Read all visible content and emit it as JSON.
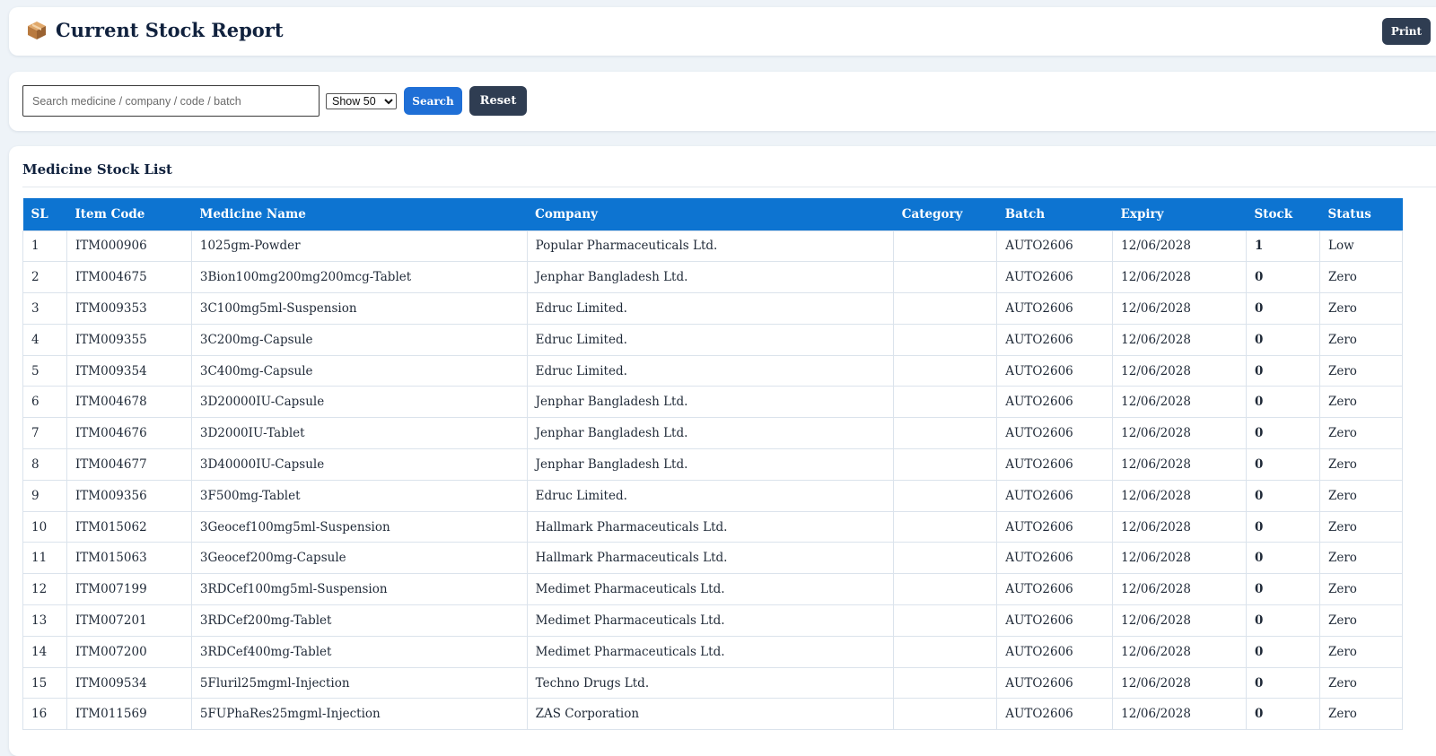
{
  "header": {
    "title": "Current Stock Report",
    "title_icon": "package-box-icon",
    "print_label": "Print"
  },
  "filters": {
    "search_placeholder": "Search medicine / company / code / batch",
    "search_value": "",
    "show_selected": "Show 50",
    "search_label": "Search",
    "reset_label": "Reset"
  },
  "list": {
    "title": "Medicine Stock List",
    "columns": [
      "SL",
      "Item Code",
      "Medicine Name",
      "Company",
      "Category",
      "Batch",
      "Expiry",
      "Stock",
      "Status"
    ],
    "rows": [
      {
        "sl": "1",
        "code": "ITM000906",
        "name": "1025gm-Powder",
        "company": "Popular Pharmaceuticals Ltd.",
        "category": "",
        "batch": "AUTO2606",
        "expiry": "12/06/2028",
        "stock": "1",
        "status": "Low"
      },
      {
        "sl": "2",
        "code": "ITM004675",
        "name": "3Bion100mg200mg200mcg-Tablet",
        "company": "Jenphar Bangladesh Ltd.",
        "category": "",
        "batch": "AUTO2606",
        "expiry": "12/06/2028",
        "stock": "0",
        "status": "Zero"
      },
      {
        "sl": "3",
        "code": "ITM009353",
        "name": "3C100mg5ml-Suspension",
        "company": "Edruc Limited.",
        "category": "",
        "batch": "AUTO2606",
        "expiry": "12/06/2028",
        "stock": "0",
        "status": "Zero"
      },
      {
        "sl": "4",
        "code": "ITM009355",
        "name": "3C200mg-Capsule",
        "company": "Edruc Limited.",
        "category": "",
        "batch": "AUTO2606",
        "expiry": "12/06/2028",
        "stock": "0",
        "status": "Zero"
      },
      {
        "sl": "5",
        "code": "ITM009354",
        "name": "3C400mg-Capsule",
        "company": "Edruc Limited.",
        "category": "",
        "batch": "AUTO2606",
        "expiry": "12/06/2028",
        "stock": "0",
        "status": "Zero"
      },
      {
        "sl": "6",
        "code": "ITM004678",
        "name": "3D20000IU-Capsule",
        "company": "Jenphar Bangladesh Ltd.",
        "category": "",
        "batch": "AUTO2606",
        "expiry": "12/06/2028",
        "stock": "0",
        "status": "Zero"
      },
      {
        "sl": "7",
        "code": "ITM004676",
        "name": "3D2000IU-Tablet",
        "company": "Jenphar Bangladesh Ltd.",
        "category": "",
        "batch": "AUTO2606",
        "expiry": "12/06/2028",
        "stock": "0",
        "status": "Zero"
      },
      {
        "sl": "8",
        "code": "ITM004677",
        "name": "3D40000IU-Capsule",
        "company": "Jenphar Bangladesh Ltd.",
        "category": "",
        "batch": "AUTO2606",
        "expiry": "12/06/2028",
        "stock": "0",
        "status": "Zero"
      },
      {
        "sl": "9",
        "code": "ITM009356",
        "name": "3F500mg-Tablet",
        "company": "Edruc Limited.",
        "category": "",
        "batch": "AUTO2606",
        "expiry": "12/06/2028",
        "stock": "0",
        "status": "Zero"
      },
      {
        "sl": "10",
        "code": "ITM015062",
        "name": "3Geocef100mg5ml-Suspension",
        "company": "Hallmark Pharmaceuticals Ltd.",
        "category": "",
        "batch": "AUTO2606",
        "expiry": "12/06/2028",
        "stock": "0",
        "status": "Zero"
      },
      {
        "sl": "11",
        "code": "ITM015063",
        "name": "3Geocef200mg-Capsule",
        "company": "Hallmark Pharmaceuticals Ltd.",
        "category": "",
        "batch": "AUTO2606",
        "expiry": "12/06/2028",
        "stock": "0",
        "status": "Zero"
      },
      {
        "sl": "12",
        "code": "ITM007199",
        "name": "3RDCef100mg5ml-Suspension",
        "company": "Medimet Pharmaceuticals Ltd.",
        "category": "",
        "batch": "AUTO2606",
        "expiry": "12/06/2028",
        "stock": "0",
        "status": "Zero"
      },
      {
        "sl": "13",
        "code": "ITM007201",
        "name": "3RDCef200mg-Tablet",
        "company": "Medimet Pharmaceuticals Ltd.",
        "category": "",
        "batch": "AUTO2606",
        "expiry": "12/06/2028",
        "stock": "0",
        "status": "Zero"
      },
      {
        "sl": "14",
        "code": "ITM007200",
        "name": "3RDCef400mg-Tablet",
        "company": "Medimet Pharmaceuticals Ltd.",
        "category": "",
        "batch": "AUTO2606",
        "expiry": "12/06/2028",
        "stock": "0",
        "status": "Zero"
      },
      {
        "sl": "15",
        "code": "ITM009534",
        "name": "5Fluril25mgml-Injection",
        "company": "Techno Drugs Ltd.",
        "category": "",
        "batch": "AUTO2606",
        "expiry": "12/06/2028",
        "stock": "0",
        "status": "Zero"
      },
      {
        "sl": "16",
        "code": "ITM011569",
        "name": "5FUPhaRes25mgml-Injection",
        "company": "ZAS Corporation",
        "category": "",
        "batch": "AUTO2606",
        "expiry": "12/06/2028",
        "stock": "0",
        "status": "Zero"
      }
    ]
  },
  "colors": {
    "table_header": "#0d74d1",
    "search_button": "#1f6fd6",
    "dark_button": "#2f3d52",
    "page_background": "#eef3f8"
  }
}
